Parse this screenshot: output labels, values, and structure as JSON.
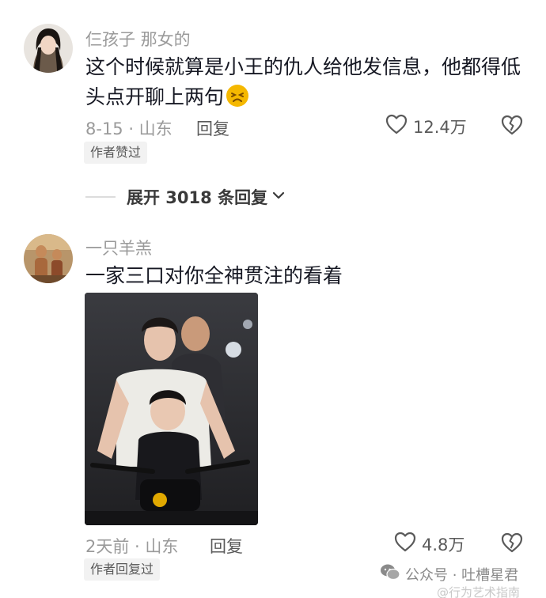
{
  "comments": [
    {
      "username": "仨孩子 那女的",
      "text": "这个时候就算是小王的仇人给他发信息，他都得低头点开聊上两句",
      "emoji": "😣",
      "time_location": "8-15 · 山东",
      "reply_label": "回复",
      "like_count": "12.4万",
      "badge": "作者赞过"
    },
    {
      "username": "一只羊羔",
      "text": "一家三口对你全神贯注的看着",
      "time_location": "2天前 · 山东",
      "reply_label": "回复",
      "like_count": "4.8万",
      "badge": "作者回复过"
    }
  ],
  "expand_replies": "展开 3018 条回复",
  "watermark": {
    "label": "公众号 · 吐槽星君",
    "sub": "@行为艺术指南"
  },
  "colors": {
    "text": "#161823",
    "secondary": "#9a9a9a",
    "badge_bg": "#f2f2f2",
    "emoji": "#f5b800"
  },
  "icons": [
    "heart-icon",
    "broken-heart-icon",
    "chevron-down-icon",
    "wechat-icon"
  ]
}
